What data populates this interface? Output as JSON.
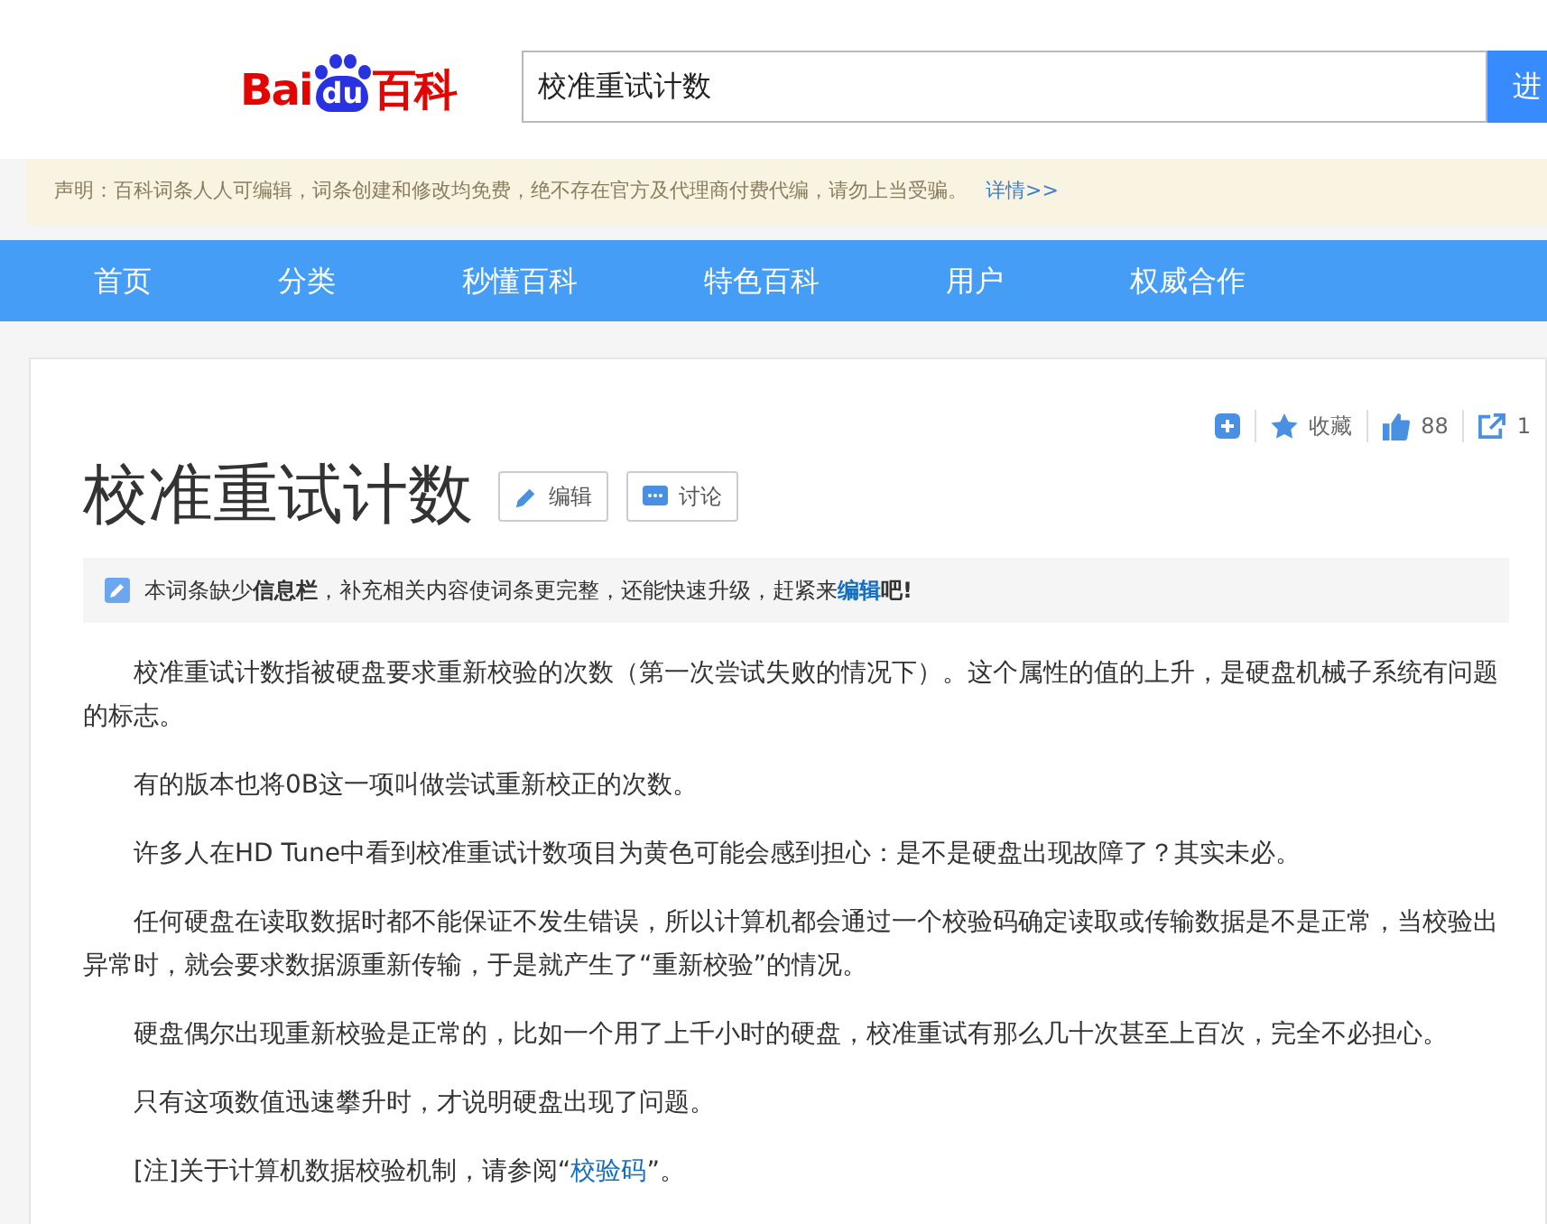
{
  "logo": {
    "parts": [
      {
        "text": "Bai",
        "kind": "word"
      },
      {
        "text": "du",
        "kind": "paw"
      },
      {
        "text": "百科",
        "kind": "word"
      }
    ]
  },
  "search": {
    "value": "校准重试计数",
    "button": "进"
  },
  "notice": {
    "text": "声明：百科词条人人可编辑，词条创建和修改均免费，绝不存在官方及代理商付费代编，请勿上当受骗。",
    "link": "详情>>"
  },
  "nav": [
    {
      "label": "首页"
    },
    {
      "label": "分类"
    },
    {
      "label": "秒懂百科"
    },
    {
      "label": "特色百科"
    },
    {
      "label": "用户"
    },
    {
      "label": "权威合作"
    }
  ],
  "actions": [
    {
      "kind": "add"
    },
    {
      "kind": "star",
      "label": "收藏"
    },
    {
      "kind": "like",
      "label": "88"
    },
    {
      "kind": "share",
      "label": "1"
    }
  ],
  "title": "校准重试计数",
  "title_buttons": [
    {
      "kind": "edit",
      "label": "编辑"
    },
    {
      "kind": "discuss",
      "label": "讨论"
    }
  ],
  "info_bar": [
    {
      "kind": "text",
      "text": "本词条缺少**信息栏**，补充相关内容使词条更完整，还能快速升级，赶紧来"
    },
    {
      "kind": "link",
      "text": "编辑"
    },
    {
      "kind": "text",
      "text": "**吧!**"
    }
  ],
  "paragraphs": [
    [
      {
        "kind": "text",
        "text": "校准重试计数指被硬盘要求重新校验的次数（第一次尝试失败的情况下）。这个属性的值的上升，是硬盘机械子系统有问题的标志。"
      }
    ],
    [
      {
        "kind": "text",
        "text": "有的版本也将0B这一项叫做尝试重新校正的次数。"
      }
    ],
    [
      {
        "kind": "text",
        "text": "许多人在HD Tune中看到校准重试计数项目为黄色可能会感到担心：是不是硬盘出现故障了？其实未必。"
      }
    ],
    [
      {
        "kind": "text",
        "text": "任何硬盘在读取数据时都不能保证不发生错误，所以计算机都会通过一个校验码确定读取或传输数据是不是正常，当校验出异常时，就会要求数据源重新传输，于是就产生了“重新校验”的情况。"
      }
    ],
    [
      {
        "kind": "text",
        "text": "硬盘偶尔出现重新校验是正常的，比如一个用了上千小时的硬盘，校准重试有那么几十次甚至上百次，完全不必担心。"
      }
    ],
    [
      {
        "kind": "text",
        "text": "只有这项数值迅速攀升时，才说明硬盘出现了问题。"
      }
    ],
    [
      {
        "kind": "text",
        "text": "[注]关于计算机数据校验机制，请参阅“"
      },
      {
        "kind": "link",
        "text": "校验码"
      },
      {
        "kind": "text",
        "text": "”。"
      }
    ]
  ]
}
